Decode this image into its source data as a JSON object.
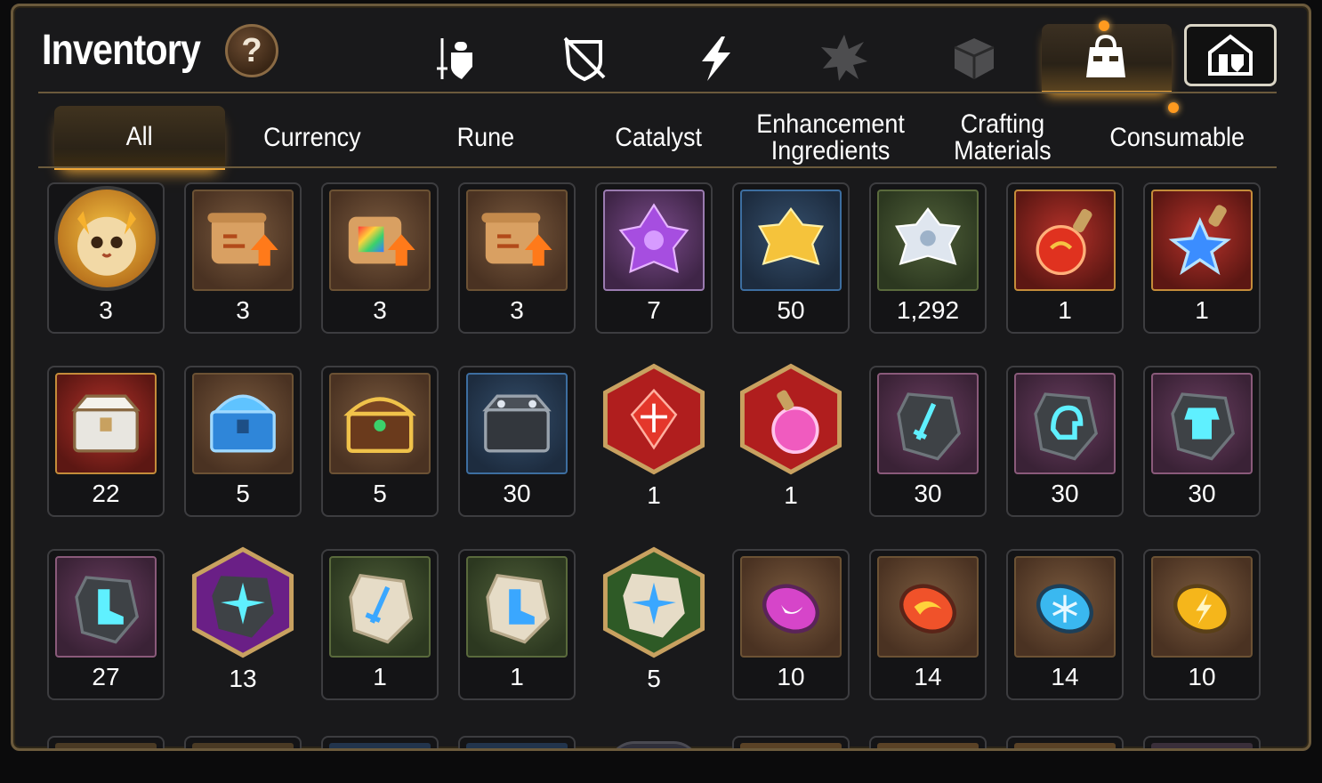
{
  "header": {
    "title": "Inventory",
    "help_label": "?"
  },
  "category_icons": [
    {
      "name": "equipment",
      "icon": "sword-shield-icon",
      "active": false
    },
    {
      "name": "no-equip",
      "icon": "crossed-shield-icon",
      "active": false
    },
    {
      "name": "skills",
      "icon": "lightning-icon",
      "active": false
    },
    {
      "name": "artifact",
      "icon": "burst-icon",
      "active": false
    },
    {
      "name": "box",
      "icon": "cube-icon",
      "active": false
    },
    {
      "name": "bag",
      "icon": "bag-icon",
      "active": true,
      "notification": true
    },
    {
      "name": "storage",
      "icon": "storage-house-icon",
      "active": false
    }
  ],
  "tabs": [
    {
      "label": "All",
      "active": true
    },
    {
      "label": "Currency",
      "active": false
    },
    {
      "label": "Rune",
      "active": false
    },
    {
      "label": "Catalyst",
      "active": false
    },
    {
      "label": "Enhancement\nIngredients",
      "active": false
    },
    {
      "label": "Crafting\nMaterials",
      "active": false
    },
    {
      "label": "Consumable",
      "active": false,
      "notification": true
    }
  ],
  "items": [
    {
      "name": "phantasma-summon-token",
      "icon": "creature-portrait-icon",
      "count": "3"
    },
    {
      "name": "scroll-upgrade-a",
      "icon": "scroll-upgrade-icon",
      "count": "3"
    },
    {
      "name": "scroll-upgrade-rainbow",
      "icon": "rainbow-scroll-icon",
      "count": "3"
    },
    {
      "name": "scroll-upgrade-b",
      "icon": "scroll-upgrade-icon",
      "count": "3"
    },
    {
      "name": "purple-crystal",
      "icon": "purple-crystal-icon",
      "count": "7"
    },
    {
      "name": "gold-crystal",
      "icon": "gold-crystal-icon",
      "count": "50"
    },
    {
      "name": "silver-crystal",
      "icon": "silver-crystal-icon",
      "count": "1,292"
    },
    {
      "name": "red-potion",
      "icon": "red-potion-icon",
      "count": "1"
    },
    {
      "name": "star-potion",
      "icon": "star-potion-icon",
      "count": "1"
    },
    {
      "name": "silver-chest",
      "icon": "silver-chest-icon",
      "count": "22"
    },
    {
      "name": "blue-chest",
      "icon": "blue-chest-icon",
      "count": "5"
    },
    {
      "name": "gold-chest",
      "icon": "gold-chest-icon",
      "count": "5"
    },
    {
      "name": "dark-chest",
      "icon": "dark-chest-icon",
      "count": "30"
    },
    {
      "name": "red-gem-hex",
      "icon": "red-gem-icon",
      "count": "1"
    },
    {
      "name": "pink-potion-hex",
      "icon": "pink-potion-icon",
      "count": "1"
    },
    {
      "name": "rune-sword",
      "icon": "rune-sword-icon",
      "count": "30"
    },
    {
      "name": "rune-helmet",
      "icon": "rune-helmet-icon",
      "count": "30"
    },
    {
      "name": "rune-armor",
      "icon": "rune-armor-icon",
      "count": "30"
    },
    {
      "name": "rune-boots",
      "icon": "rune-boots-icon",
      "count": "27"
    },
    {
      "name": "rune-star-hex",
      "icon": "rune-star-icon",
      "count": "13"
    },
    {
      "name": "stone-sword",
      "icon": "stone-sword-icon",
      "count": "1"
    },
    {
      "name": "stone-boots",
      "icon": "stone-boots-icon",
      "count": "1"
    },
    {
      "name": "stone-star-hex",
      "icon": "stone-star-icon",
      "count": "5"
    },
    {
      "name": "moon-orb",
      "icon": "moon-orb-icon",
      "count": "10"
    },
    {
      "name": "fire-orb",
      "icon": "fire-orb-icon",
      "count": "14"
    },
    {
      "name": "ice-orb",
      "icon": "ice-orb-icon",
      "count": "14"
    },
    {
      "name": "lightning-orb",
      "icon": "lightning-orb-icon",
      "count": "10"
    }
  ],
  "colors": {
    "accent": "#f0a838",
    "frame": "#6b5a3c",
    "cell_border": "#3d3d40"
  }
}
